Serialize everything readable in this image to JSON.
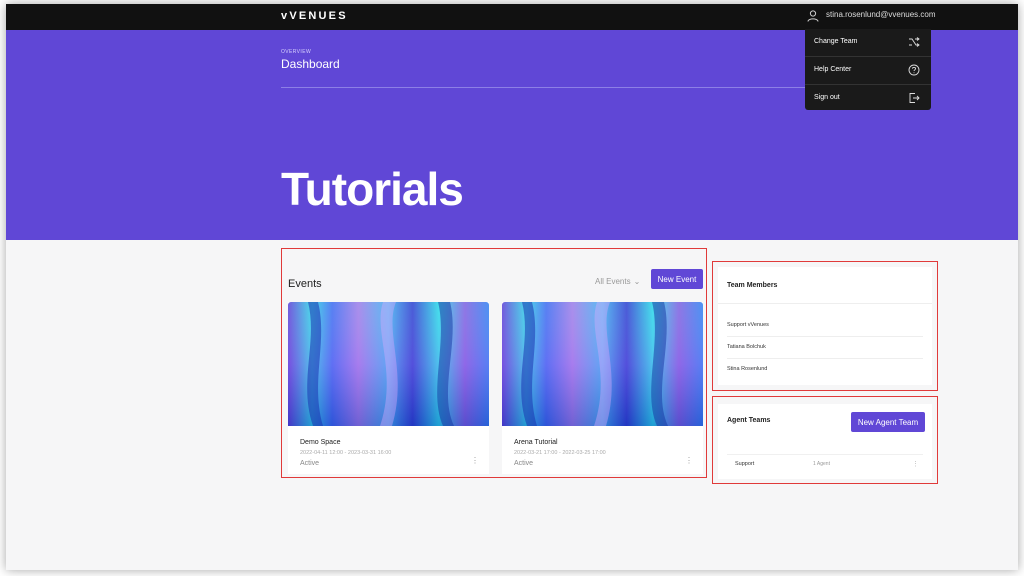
{
  "header": {
    "logo": "vVENUES",
    "user_email": "stina.rosenlund@vvenues.com"
  },
  "user_menu": {
    "items": [
      {
        "label": "Change Team",
        "icon": "shuffle-icon"
      },
      {
        "label": "Help Center",
        "icon": "question-circle-icon"
      },
      {
        "label": "Sign out",
        "icon": "sign-out-icon"
      }
    ]
  },
  "hero": {
    "overline": "OVERVIEW",
    "subtitle": "Dashboard",
    "title": "Tutorials",
    "bg_color": "#6047d6"
  },
  "events": {
    "title": "Events",
    "filter_label": "All Events",
    "new_button": "New Event",
    "cards": [
      {
        "name": "Demo Space",
        "dates": "2022-04-11 12:00 - 2023-03-31 16:00",
        "status": "Active"
      },
      {
        "name": "Arena Tutorial",
        "dates": "2022-03-21 17:00 - 2022-03-25 17:00",
        "status": "Active"
      }
    ]
  },
  "team_members": {
    "title": "Team Members",
    "members": [
      "Support vVenues",
      "Tatiana Bolchuk",
      "Stina Rosenlund"
    ]
  },
  "agent_teams": {
    "title": "Agent Teams",
    "new_button": "New Agent Team",
    "rows": [
      {
        "name": "Support",
        "count": "1 Agent"
      }
    ]
  },
  "colors": {
    "accent": "#6047d6",
    "topbar": "#111111",
    "highlight_border": "#e03a3a"
  }
}
